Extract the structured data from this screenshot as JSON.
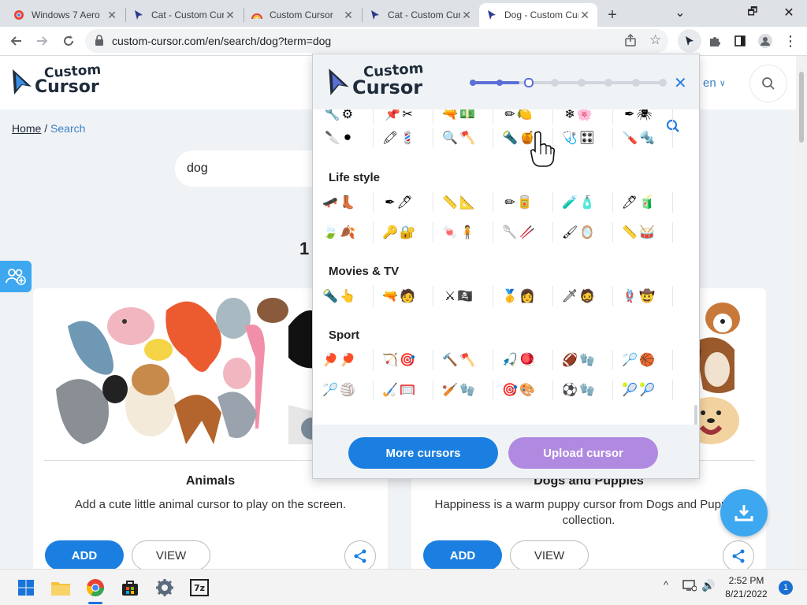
{
  "browser": {
    "tabs": [
      {
        "title": "Windows 7 Aero",
        "icon": "chrome-web-store-icon"
      },
      {
        "title": "Cat - Custom Cursor",
        "icon": "custom-cursor-icon"
      },
      {
        "title": "Custom Cursor",
        "icon": "rainbow-icon"
      },
      {
        "title": "Cat - Custom Cursor",
        "icon": "custom-cursor-icon"
      },
      {
        "title": "Dog - Custom Cursor",
        "icon": "custom-cursor-icon",
        "active": true
      }
    ],
    "new_tab": "+",
    "url": "custom-cursor.com/en/search/dog?term=dog",
    "window_controls": {
      "minimize": "⌄",
      "restore": "🗗",
      "close": "✕"
    }
  },
  "site": {
    "logo_line1": "Custom",
    "logo_line2": "Cursor",
    "language": "en",
    "breadcrumb": {
      "home": "Home",
      "separator": "/",
      "current": "Search"
    },
    "search_value": "dog",
    "result_count_partial": "1",
    "cards": [
      {
        "title": "Animals",
        "description": "Add a cute little animal cursor to play on the screen.",
        "add": "ADD",
        "view": "VIEW"
      },
      {
        "title": "Dogs and Puppies",
        "description": "Happiness is a warm puppy cursor from Dogs and Puppies collection.",
        "add": "ADD",
        "view": "VIEW"
      }
    ]
  },
  "popup": {
    "logo_line1": "Custom",
    "logo_line2": "Cursor",
    "progress": 0.25,
    "progress_steps": 8,
    "progress_current_step": 3,
    "close": "✕",
    "sections": [
      {
        "title": "Life style"
      },
      {
        "title": "Movies & TV"
      },
      {
        "title": "Sport"
      }
    ],
    "rows": {
      "partial_top": [
        "🔧⚙",
        "📌✂",
        "🔫💵",
        "✏🍋",
        "❄🌸",
        "✒🕷"
      ],
      "tools": [
        "🔪⚫",
        "🖍💈",
        "🔍🪓",
        "🔦🍯",
        "🩺🎛",
        "🪛🔩"
      ],
      "life1": [
        "🛹👢",
        "✒🖊",
        "📏📐",
        "✏🥫",
        "🧪🧴",
        "🖊🧃"
      ],
      "life2": [
        "🍃🍂",
        "🔑🔐",
        "🍬🧍",
        "🥄🥢",
        "🖌🪞",
        "📏🥁"
      ],
      "movies": [
        "🔦👆",
        "🔫🧑",
        "⚔🏴‍☠",
        "🥇👩",
        "🗡🧔",
        "🪢🤠"
      ],
      "sport1": [
        "🏓🏓",
        "🏹🎯",
        "🔨🪓",
        "🎣🪀",
        "🏈🧤",
        "🏸🏀"
      ],
      "sport2": [
        "🏸🏐",
        "🏑🥅",
        "🏏🧤",
        "🎯🎨",
        "⚽🧤",
        "🎾🎾"
      ]
    },
    "more_button": "More cursors",
    "upload_button": "Upload cursor",
    "colors": {
      "more": "#1a7fe0",
      "upload": "#b08ae0",
      "accent": "#2b7de0"
    }
  },
  "taskbar": {
    "icons": [
      "windows-start-icon",
      "file-explorer-icon",
      "chrome-icon",
      "store-icon",
      "settings-icon",
      "7zip-icon"
    ],
    "sevenzip_label": "7z",
    "time": "2:52 PM",
    "date": "8/21/2022",
    "notification_count": "1",
    "tray": {
      "chevron": "^",
      "volume": "🔊"
    }
  }
}
